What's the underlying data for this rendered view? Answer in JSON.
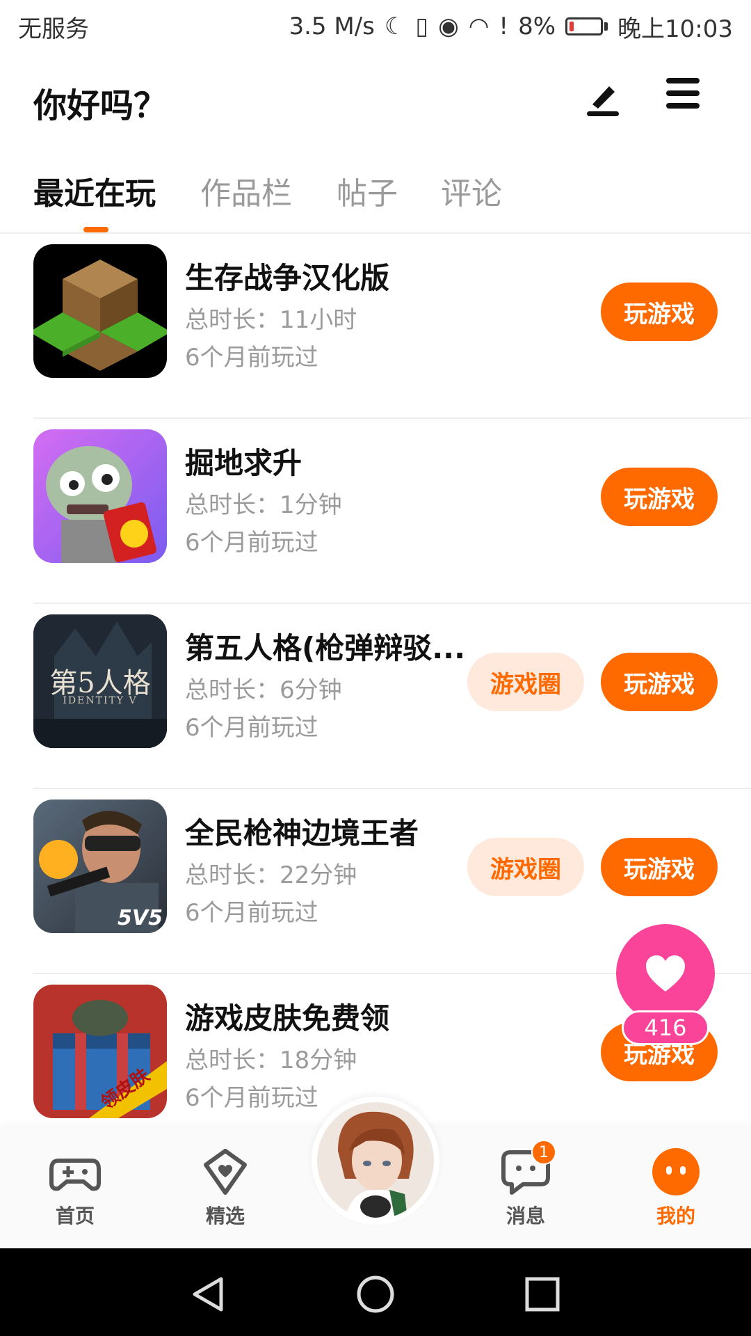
{
  "status_bar": {
    "carrier": "无服务",
    "net_speed": "3.5 M/s",
    "battery_percent": "8%",
    "time": "晚上10:03"
  },
  "header": {
    "title": "你好吗？",
    "edit_icon": "pen-icon",
    "menu_icon": "hamburger-menu-icon"
  },
  "tabs": [
    {
      "label": "最近在玩",
      "active": true
    },
    {
      "label": "作品栏",
      "active": false
    },
    {
      "label": "帖子",
      "active": false
    },
    {
      "label": "评论",
      "active": false
    }
  ],
  "games": [
    {
      "name": "生存战争汉化版",
      "duration": "总时长：11小时",
      "last_played": "6个月前玩过",
      "circle_label": "",
      "play_label": "玩游戏"
    },
    {
      "name": "掘地求升",
      "duration": "总时长：1分钟",
      "last_played": "6个月前玩过",
      "circle_label": "",
      "play_label": "玩游戏"
    },
    {
      "name": "第五人格(枪弹辩驳...",
      "duration": "总时长：6分钟",
      "last_played": "6个月前玩过",
      "circle_label": "游戏圈",
      "play_label": "玩游戏",
      "thumb_text": "第5人格",
      "thumb_sub": "IDENTITY V"
    },
    {
      "name": "全民枪神边境王者",
      "duration": "总时长：22分钟",
      "last_played": "6个月前玩过",
      "circle_label": "游戏圈",
      "play_label": "玩游戏",
      "thumb_text": "5V5"
    },
    {
      "name": "游戏皮肤免费领",
      "duration": "总时长：18分钟",
      "last_played": "6个月前玩过",
      "circle_label": "",
      "play_label": "玩游戏",
      "thumb_text": "领皮肤"
    }
  ],
  "like_fab": {
    "icon": "heart-icon",
    "count": "416"
  },
  "bottom_nav": [
    {
      "label": "首页",
      "icon": "gamepad-icon",
      "active": false
    },
    {
      "label": "精选",
      "icon": "heart-bubble-icon",
      "active": false
    },
    {
      "label": "消息",
      "icon": "chat-icon",
      "active": false,
      "badge": "1"
    },
    {
      "label": "我的",
      "icon": "profile-face-icon",
      "active": true
    }
  ],
  "colors": {
    "accent": "#ff6a00",
    "accent_light": "#ffe9dc",
    "pink": "#f9449a"
  }
}
